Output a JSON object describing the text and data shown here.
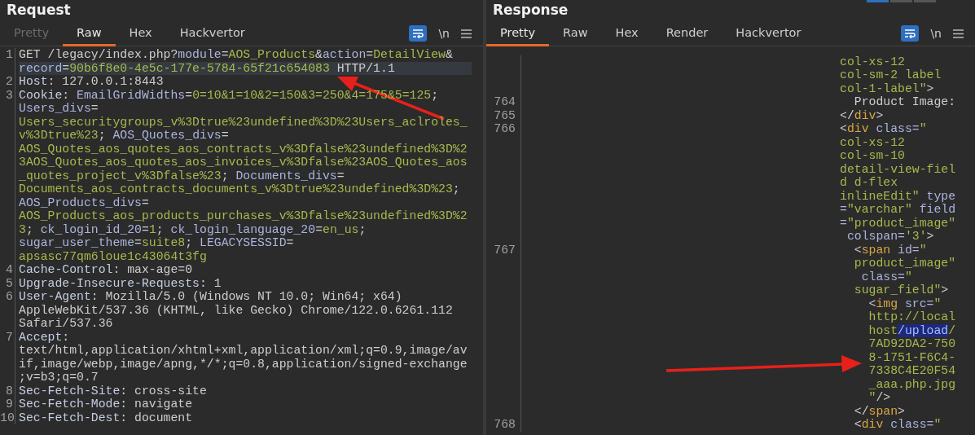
{
  "request": {
    "title": "Request",
    "tabs": [
      {
        "label": "Pretty",
        "selected": false,
        "disabled": true
      },
      {
        "label": "Raw",
        "selected": true,
        "disabled": false
      },
      {
        "label": "Hex",
        "selected": false,
        "disabled": false
      },
      {
        "label": "Hackvertor",
        "selected": false,
        "disabled": false
      }
    ],
    "newline_toggle": "\\n",
    "lines": [
      {
        "number": "1",
        "rows": [
          {
            "current": false,
            "s": [
              {
                "kind": "txt",
                "text": "GET /legacy/index.php?"
              },
              {
                "kind": "key",
                "text": "module"
              },
              {
                "kind": "txt",
                "text": "="
              },
              {
                "kind": "val",
                "text": "AOS_Products"
              },
              {
                "kind": "txt",
                "text": "&"
              },
              {
                "kind": "key",
                "text": "action"
              },
              {
                "kind": "txt",
                "text": "="
              },
              {
                "kind": "val",
                "text": "DetailView"
              },
              {
                "kind": "txt",
                "text": "&"
              }
            ]
          },
          {
            "current": true,
            "s": [
              {
                "kind": "key",
                "text": "record"
              },
              {
                "kind": "txt",
                "text": "="
              },
              {
                "kind": "val",
                "text": "90b6f8e0-4e5c-177e-5784-65f21c654083"
              },
              {
                "kind": "txt",
                "text": " HTTP/1.1"
              }
            ]
          }
        ]
      },
      {
        "number": "2",
        "rows": [
          {
            "current": false,
            "s": [
              {
                "kind": "hdr",
                "text": "Host"
              },
              {
                "kind": "txt",
                "text": ": 127.0.0.1:8443"
              }
            ]
          }
        ]
      },
      {
        "number": "3",
        "rows": [
          {
            "current": false,
            "s": [
              {
                "kind": "hdr",
                "text": "Cookie"
              },
              {
                "kind": "txt",
                "text": ": "
              },
              {
                "kind": "key",
                "text": "EmailGridWidths"
              },
              {
                "kind": "txt",
                "text": "="
              },
              {
                "kind": "val",
                "text": "0=10&1=10&2=150&3=250&4=175&5=125"
              },
              {
                "kind": "txt",
                "text": ";"
              }
            ]
          },
          {
            "current": false,
            "s": [
              {
                "kind": "key",
                "text": "Users_divs"
              },
              {
                "kind": "txt",
                "text": "="
              }
            ]
          },
          {
            "current": false,
            "s": [
              {
                "kind": "val",
                "text": "Users_securitygroups_v%3Dtrue%23undefined%3D%23Users_aclroles_"
              }
            ]
          },
          {
            "current": false,
            "s": [
              {
                "kind": "val",
                "text": "v%3Dtrue%23"
              },
              {
                "kind": "txt",
                "text": "; "
              },
              {
                "kind": "key",
                "text": "AOS_Quotes_divs"
              },
              {
                "kind": "txt",
                "text": "="
              }
            ]
          },
          {
            "current": false,
            "s": [
              {
                "kind": "val",
                "text": "AOS_Quotes_aos_quotes_aos_contracts_v%3Dfalse%23undefined%3D%2"
              }
            ]
          },
          {
            "current": false,
            "s": [
              {
                "kind": "val",
                "text": "3AOS_Quotes_aos_quotes_aos_invoices_v%3Dfalse%23AOS_Quotes_aos"
              }
            ]
          },
          {
            "current": false,
            "s": [
              {
                "kind": "val",
                "text": "_quotes_project_v%3Dfalse%23"
              },
              {
                "kind": "txt",
                "text": "; "
              },
              {
                "kind": "key",
                "text": "Documents_divs"
              },
              {
                "kind": "txt",
                "text": "="
              }
            ]
          },
          {
            "current": false,
            "s": [
              {
                "kind": "val",
                "text": "Documents_aos_contracts_documents_v%3Dtrue%23undefined%3D%23"
              },
              {
                "kind": "txt",
                "text": ";"
              }
            ]
          },
          {
            "current": false,
            "s": [
              {
                "kind": "key",
                "text": "AOS_Products_divs"
              },
              {
                "kind": "txt",
                "text": "="
              }
            ]
          },
          {
            "current": false,
            "s": [
              {
                "kind": "val",
                "text": "AOS_Products_aos_products_purchases_v%3Dfalse%23undefined%3D%2"
              }
            ]
          },
          {
            "current": false,
            "s": [
              {
                "kind": "val",
                "text": "3"
              },
              {
                "kind": "txt",
                "text": "; "
              },
              {
                "kind": "key",
                "text": "ck_login_id_20"
              },
              {
                "kind": "txt",
                "text": "="
              },
              {
                "kind": "val",
                "text": "1"
              },
              {
                "kind": "txt",
                "text": "; "
              },
              {
                "kind": "key",
                "text": "ck_login_language_20"
              },
              {
                "kind": "txt",
                "text": "="
              },
              {
                "kind": "val",
                "text": "en_us"
              },
              {
                "kind": "txt",
                "text": ";"
              }
            ]
          },
          {
            "current": false,
            "s": [
              {
                "kind": "key",
                "text": "sugar_user_theme"
              },
              {
                "kind": "txt",
                "text": "="
              },
              {
                "kind": "val",
                "text": "suite8"
              },
              {
                "kind": "txt",
                "text": "; "
              },
              {
                "kind": "key",
                "text": "LEGACYSESSID"
              },
              {
                "kind": "txt",
                "text": "="
              }
            ]
          },
          {
            "current": false,
            "s": [
              {
                "kind": "val",
                "text": "apsasc77qm6loue1c43064t3fg"
              }
            ]
          }
        ]
      },
      {
        "number": "4",
        "rows": [
          {
            "current": false,
            "s": [
              {
                "kind": "hdr",
                "text": "Cache-Control"
              },
              {
                "kind": "txt",
                "text": ": max-age=0"
              }
            ]
          }
        ]
      },
      {
        "number": "5",
        "rows": [
          {
            "current": false,
            "s": [
              {
                "kind": "hdr",
                "text": "Upgrade-Insecure-Requests"
              },
              {
                "kind": "txt",
                "text": ": 1"
              }
            ]
          }
        ]
      },
      {
        "number": "6",
        "rows": [
          {
            "current": false,
            "s": [
              {
                "kind": "hdr",
                "text": "User-Agent"
              },
              {
                "kind": "txt",
                "text": ": Mozilla/5.0 (Windows NT 10.0; Win64; x64)"
              }
            ]
          },
          {
            "current": false,
            "s": [
              {
                "kind": "txt",
                "text": "AppleWebKit/537.36 (KHTML, like Gecko) Chrome/122.0.6261.112"
              }
            ]
          },
          {
            "current": false,
            "s": [
              {
                "kind": "txt",
                "text": "Safari/537.36"
              }
            ]
          }
        ]
      },
      {
        "number": "7",
        "rows": [
          {
            "current": false,
            "s": [
              {
                "kind": "hdr",
                "text": "Accept"
              },
              {
                "kind": "txt",
                "text": ":"
              }
            ]
          },
          {
            "current": false,
            "s": [
              {
                "kind": "txt",
                "text": "text/html,application/xhtml+xml,application/xml;q=0.9,image/av"
              }
            ]
          },
          {
            "current": false,
            "s": [
              {
                "kind": "txt",
                "text": "if,image/webp,image/apng,*/*;q=0.8,application/signed-exchange"
              }
            ]
          },
          {
            "current": false,
            "s": [
              {
                "kind": "txt",
                "text": ";v=b3;q=0.7"
              }
            ]
          }
        ]
      },
      {
        "number": "8",
        "rows": [
          {
            "current": false,
            "s": [
              {
                "kind": "hdr",
                "text": "Sec-Fetch-Site"
              },
              {
                "kind": "txt",
                "text": ": cross-site"
              }
            ]
          }
        ]
      },
      {
        "number": "9",
        "rows": [
          {
            "current": false,
            "s": [
              {
                "kind": "hdr",
                "text": "Sec-Fetch-Mode"
              },
              {
                "kind": "txt",
                "text": ": navigate"
              }
            ]
          }
        ]
      },
      {
        "number": "10",
        "rows": [
          {
            "current": false,
            "s": [
              {
                "kind": "hdr",
                "text": "Sec-Fetch-Dest"
              },
              {
                "kind": "txt",
                "text": ": document"
              }
            ]
          }
        ]
      }
    ]
  },
  "response": {
    "title": "Response",
    "tabs": [
      {
        "label": "Pretty",
        "selected": true,
        "disabled": false
      },
      {
        "label": "Raw",
        "selected": false,
        "disabled": false
      },
      {
        "label": "Hex",
        "selected": false,
        "disabled": false
      },
      {
        "label": "Render",
        "selected": false,
        "disabled": false
      },
      {
        "label": "Hackvertor",
        "selected": false,
        "disabled": false
      }
    ],
    "newline_toggle": "\\n",
    "lines": [
      {
        "rows": [
          {
            "current": false,
            "s": [
              {
                "kind": "val",
                "text": "col-xs-12"
              }
            ]
          },
          {
            "current": false,
            "s": [
              {
                "kind": "val",
                "text": "col-sm-2 label"
              }
            ]
          },
          {
            "current": false,
            "s": [
              {
                "kind": "val",
                "text": "col-1-label\""
              },
              {
                "kind": "txt",
                "text": ">"
              }
            ]
          }
        ]
      },
      {
        "number": "764",
        "rows": [
          {
            "current": false,
            "s": [
              {
                "kind": "txt",
                "text": "  Product Image:"
              }
            ]
          }
        ]
      },
      {
        "number": "765",
        "rows": [
          {
            "current": false,
            "s": [
              {
                "kind": "txt",
                "text": "</"
              },
              {
                "kind": "tag",
                "text": "div"
              },
              {
                "kind": "txt",
                "text": ">"
              }
            ]
          }
        ]
      },
      {
        "number": "766",
        "rows": [
          {
            "current": false,
            "s": [
              {
                "kind": "txt",
                "text": "<"
              },
              {
                "kind": "tag",
                "text": "div"
              },
              {
                "kind": "key",
                "text": " class="
              },
              {
                "kind": "val",
                "text": "\""
              }
            ]
          },
          {
            "current": false,
            "s": [
              {
                "kind": "val",
                "text": "col-xs-12"
              }
            ]
          },
          {
            "current": false,
            "s": [
              {
                "kind": "val",
                "text": "col-sm-10"
              }
            ]
          },
          {
            "current": false,
            "s": [
              {
                "kind": "val",
                "text": "detail-view-fiel"
              }
            ]
          },
          {
            "current": false,
            "s": [
              {
                "kind": "val",
                "text": "d d-flex"
              }
            ]
          },
          {
            "current": false,
            "s": [
              {
                "kind": "val",
                "text": "inlineEdit\""
              },
              {
                "kind": "key",
                "text": " type"
              }
            ]
          },
          {
            "current": false,
            "s": [
              {
                "kind": "key",
                "text": "="
              },
              {
                "kind": "val",
                "text": "\"varchar\""
              },
              {
                "kind": "key",
                "text": " field"
              }
            ]
          },
          {
            "current": false,
            "s": [
              {
                "kind": "key",
                "text": "="
              },
              {
                "kind": "val",
                "text": "\"product_image\""
              }
            ]
          },
          {
            "current": false,
            "s": [
              {
                "kind": "key",
                "text": " colspan="
              },
              {
                "kind": "val",
                "text": "'3'"
              },
              {
                "kind": "txt",
                "text": ">"
              }
            ]
          }
        ]
      },
      {
        "number": "767",
        "rows": [
          {
            "current": false,
            "s": [
              {
                "kind": "txt",
                "text": "  <"
              },
              {
                "kind": "tag",
                "text": "span"
              },
              {
                "kind": "key",
                "text": " id="
              },
              {
                "kind": "val",
                "text": "\""
              }
            ]
          },
          {
            "current": false,
            "s": [
              {
                "kind": "val",
                "text": "  product_image\""
              }
            ]
          },
          {
            "current": false,
            "s": [
              {
                "kind": "key",
                "text": "   class="
              },
              {
                "kind": "val",
                "text": "\""
              }
            ]
          },
          {
            "current": false,
            "s": [
              {
                "kind": "val",
                "text": "  sugar_field\""
              },
              {
                "kind": "txt",
                "text": ">"
              }
            ]
          },
          {
            "current": false,
            "s": [
              {
                "kind": "txt",
                "text": "    <"
              },
              {
                "kind": "tag",
                "text": "img"
              },
              {
                "kind": "key",
                "text": " src="
              },
              {
                "kind": "val",
                "text": "\""
              }
            ]
          },
          {
            "current": false,
            "s": [
              {
                "kind": "val",
                "text": "    http://local"
              }
            ]
          },
          {
            "current": false,
            "s": [
              {
                "kind": "val",
                "text": "    host"
              },
              {
                "kind": "sel",
                "text": "/upload"
              },
              {
                "kind": "val",
                "text": "/"
              }
            ]
          },
          {
            "current": false,
            "s": [
              {
                "kind": "val",
                "text": "    7AD92DA2-750"
              }
            ]
          },
          {
            "current": false,
            "s": [
              {
                "kind": "val",
                "text": "    8-1751-F6C4-"
              }
            ]
          },
          {
            "current": false,
            "s": [
              {
                "kind": "val",
                "text": "    7338C4E20F54"
              }
            ]
          },
          {
            "current": false,
            "s": [
              {
                "kind": "val",
                "text": "    _aaa.php.jpg"
              }
            ]
          },
          {
            "current": false,
            "s": [
              {
                "kind": "val",
                "text": "    \""
              },
              {
                "kind": "txt",
                "text": "/>"
              }
            ]
          },
          {
            "current": false,
            "s": [
              {
                "kind": "txt",
                "text": "  </"
              },
              {
                "kind": "tag",
                "text": "span"
              },
              {
                "kind": "txt",
                "text": ">"
              }
            ]
          }
        ]
      },
      {
        "number": "768",
        "rows": [
          {
            "current": false,
            "s": [
              {
                "kind": "txt",
                "text": "  <"
              },
              {
                "kind": "tag",
                "text": "div"
              },
              {
                "kind": "key",
                "text": " class="
              },
              {
                "kind": "val",
                "text": "\""
              }
            ]
          }
        ]
      }
    ]
  }
}
